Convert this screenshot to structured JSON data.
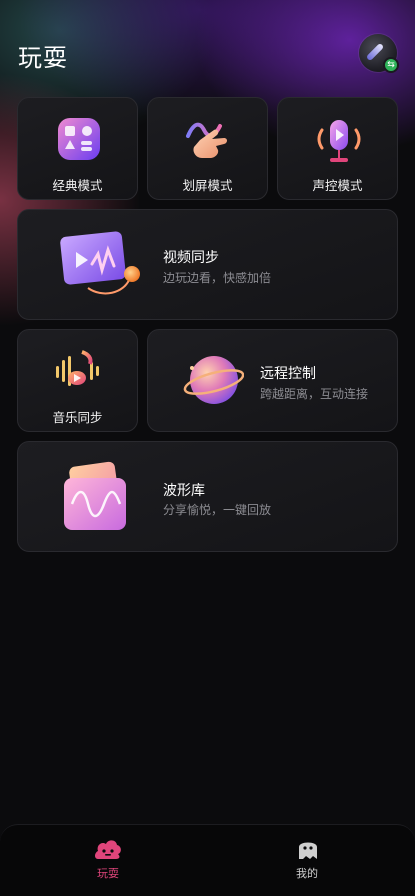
{
  "header": {
    "title": "玩耍"
  },
  "cards": {
    "classic": {
      "label": "经典模式"
    },
    "swipe": {
      "label": "划屏模式"
    },
    "voice": {
      "label": "声控模式"
    },
    "video": {
      "title": "视频同步",
      "subtitle": "边玩边看，快感加倍"
    },
    "music": {
      "label": "音乐同步"
    },
    "remote": {
      "title": "远程控制",
      "subtitle": "跨越距离，互动连接"
    },
    "waveform": {
      "title": "波形库",
      "subtitle": "分享愉悦，一键回放"
    }
  },
  "nav": {
    "items": [
      {
        "label": "玩耍",
        "icon": "play-icon",
        "active": true
      },
      {
        "label": "我的",
        "icon": "ghost-profile-icon",
        "active": false
      }
    ],
    "active_color": "#e0457b",
    "inactive_color": "#cfcfcf"
  },
  "colors": {
    "background": "#0b0b0d",
    "card": "#18181b",
    "accent_pink": "#e0457b",
    "badge_green": "#2fb35a"
  }
}
